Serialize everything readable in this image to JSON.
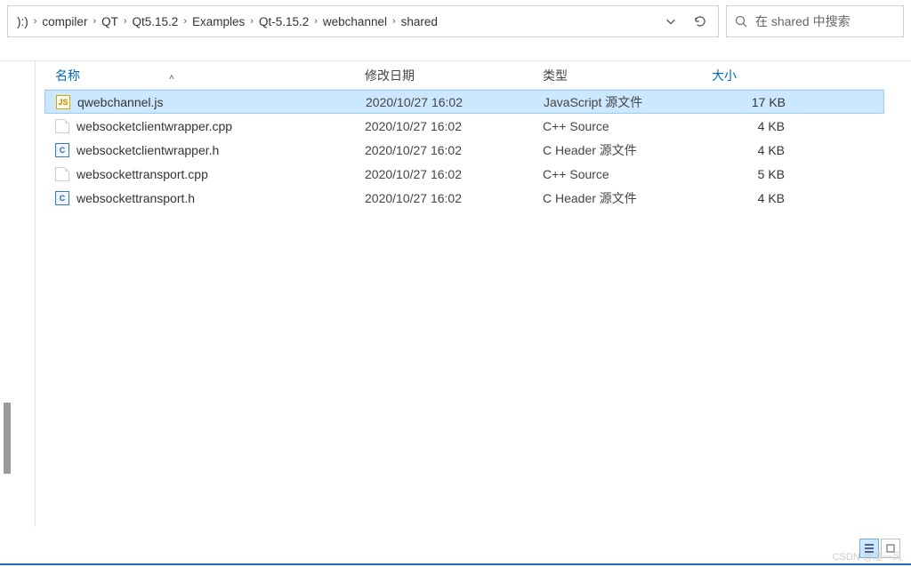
{
  "breadcrumb": {
    "drive_fragment": "):)",
    "items": [
      "compiler",
      "QT",
      "Qt5.15.2",
      "Examples",
      "Qt-5.15.2",
      "webchannel",
      "shared"
    ]
  },
  "search": {
    "placeholder": "在 shared 中搜索"
  },
  "columns": {
    "name": "名称",
    "date": "修改日期",
    "type": "类型",
    "size": "大小"
  },
  "files": [
    {
      "icon": "js",
      "name": "qwebchannel.js",
      "date": "2020/10/27 16:02",
      "type": "JavaScript 源文件",
      "size": "17 KB",
      "selected": true
    },
    {
      "icon": "blank",
      "name": "websocketclientwrapper.cpp",
      "date": "2020/10/27 16:02",
      "type": "C++ Source",
      "size": "4 KB",
      "selected": false
    },
    {
      "icon": "c",
      "name": "websocketclientwrapper.h",
      "date": "2020/10/27 16:02",
      "type": "C Header 源文件",
      "size": "4 KB",
      "selected": false
    },
    {
      "icon": "blank",
      "name": "websockettransport.cpp",
      "date": "2020/10/27 16:02",
      "type": "C++ Source",
      "size": "5 KB",
      "selected": false
    },
    {
      "icon": "c",
      "name": "websockettransport.h",
      "date": "2020/10/27 16:02",
      "type": "C Header 源文件",
      "size": "4 KB",
      "selected": false
    }
  ],
  "watermark": "CSDN @凌一风"
}
